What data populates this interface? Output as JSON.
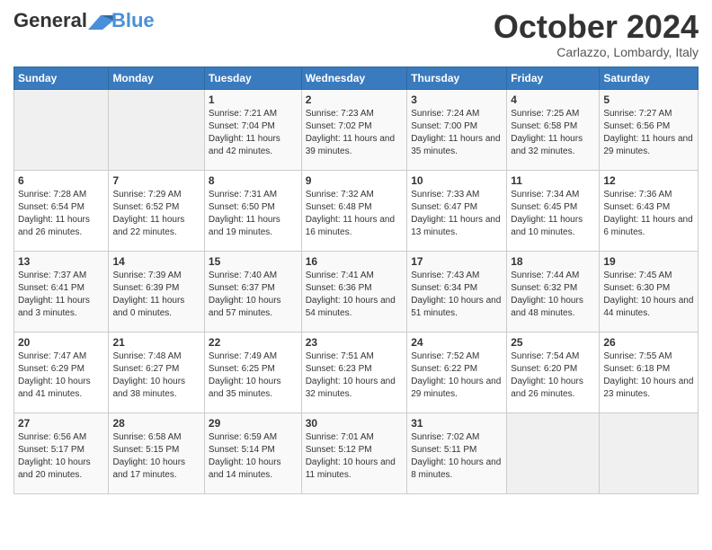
{
  "header": {
    "logo_line1": "General",
    "logo_line2": "Blue",
    "month": "October 2024",
    "location": "Carlazzo, Lombardy, Italy"
  },
  "days_of_week": [
    "Sunday",
    "Monday",
    "Tuesday",
    "Wednesday",
    "Thursday",
    "Friday",
    "Saturday"
  ],
  "weeks": [
    [
      {
        "day": "",
        "sunrise": "",
        "sunset": "",
        "daylight": ""
      },
      {
        "day": "",
        "sunrise": "",
        "sunset": "",
        "daylight": ""
      },
      {
        "day": "1",
        "sunrise": "Sunrise: 7:21 AM",
        "sunset": "Sunset: 7:04 PM",
        "daylight": "Daylight: 11 hours and 42 minutes."
      },
      {
        "day": "2",
        "sunrise": "Sunrise: 7:23 AM",
        "sunset": "Sunset: 7:02 PM",
        "daylight": "Daylight: 11 hours and 39 minutes."
      },
      {
        "day": "3",
        "sunrise": "Sunrise: 7:24 AM",
        "sunset": "Sunset: 7:00 PM",
        "daylight": "Daylight: 11 hours and 35 minutes."
      },
      {
        "day": "4",
        "sunrise": "Sunrise: 7:25 AM",
        "sunset": "Sunset: 6:58 PM",
        "daylight": "Daylight: 11 hours and 32 minutes."
      },
      {
        "day": "5",
        "sunrise": "Sunrise: 7:27 AM",
        "sunset": "Sunset: 6:56 PM",
        "daylight": "Daylight: 11 hours and 29 minutes."
      }
    ],
    [
      {
        "day": "6",
        "sunrise": "Sunrise: 7:28 AM",
        "sunset": "Sunset: 6:54 PM",
        "daylight": "Daylight: 11 hours and 26 minutes."
      },
      {
        "day": "7",
        "sunrise": "Sunrise: 7:29 AM",
        "sunset": "Sunset: 6:52 PM",
        "daylight": "Daylight: 11 hours and 22 minutes."
      },
      {
        "day": "8",
        "sunrise": "Sunrise: 7:31 AM",
        "sunset": "Sunset: 6:50 PM",
        "daylight": "Daylight: 11 hours and 19 minutes."
      },
      {
        "day": "9",
        "sunrise": "Sunrise: 7:32 AM",
        "sunset": "Sunset: 6:48 PM",
        "daylight": "Daylight: 11 hours and 16 minutes."
      },
      {
        "day": "10",
        "sunrise": "Sunrise: 7:33 AM",
        "sunset": "Sunset: 6:47 PM",
        "daylight": "Daylight: 11 hours and 13 minutes."
      },
      {
        "day": "11",
        "sunrise": "Sunrise: 7:34 AM",
        "sunset": "Sunset: 6:45 PM",
        "daylight": "Daylight: 11 hours and 10 minutes."
      },
      {
        "day": "12",
        "sunrise": "Sunrise: 7:36 AM",
        "sunset": "Sunset: 6:43 PM",
        "daylight": "Daylight: 11 hours and 6 minutes."
      }
    ],
    [
      {
        "day": "13",
        "sunrise": "Sunrise: 7:37 AM",
        "sunset": "Sunset: 6:41 PM",
        "daylight": "Daylight: 11 hours and 3 minutes."
      },
      {
        "day": "14",
        "sunrise": "Sunrise: 7:39 AM",
        "sunset": "Sunset: 6:39 PM",
        "daylight": "Daylight: 11 hours and 0 minutes."
      },
      {
        "day": "15",
        "sunrise": "Sunrise: 7:40 AM",
        "sunset": "Sunset: 6:37 PM",
        "daylight": "Daylight: 10 hours and 57 minutes."
      },
      {
        "day": "16",
        "sunrise": "Sunrise: 7:41 AM",
        "sunset": "Sunset: 6:36 PM",
        "daylight": "Daylight: 10 hours and 54 minutes."
      },
      {
        "day": "17",
        "sunrise": "Sunrise: 7:43 AM",
        "sunset": "Sunset: 6:34 PM",
        "daylight": "Daylight: 10 hours and 51 minutes."
      },
      {
        "day": "18",
        "sunrise": "Sunrise: 7:44 AM",
        "sunset": "Sunset: 6:32 PM",
        "daylight": "Daylight: 10 hours and 48 minutes."
      },
      {
        "day": "19",
        "sunrise": "Sunrise: 7:45 AM",
        "sunset": "Sunset: 6:30 PM",
        "daylight": "Daylight: 10 hours and 44 minutes."
      }
    ],
    [
      {
        "day": "20",
        "sunrise": "Sunrise: 7:47 AM",
        "sunset": "Sunset: 6:29 PM",
        "daylight": "Daylight: 10 hours and 41 minutes."
      },
      {
        "day": "21",
        "sunrise": "Sunrise: 7:48 AM",
        "sunset": "Sunset: 6:27 PM",
        "daylight": "Daylight: 10 hours and 38 minutes."
      },
      {
        "day": "22",
        "sunrise": "Sunrise: 7:49 AM",
        "sunset": "Sunset: 6:25 PM",
        "daylight": "Daylight: 10 hours and 35 minutes."
      },
      {
        "day": "23",
        "sunrise": "Sunrise: 7:51 AM",
        "sunset": "Sunset: 6:23 PM",
        "daylight": "Daylight: 10 hours and 32 minutes."
      },
      {
        "day": "24",
        "sunrise": "Sunrise: 7:52 AM",
        "sunset": "Sunset: 6:22 PM",
        "daylight": "Daylight: 10 hours and 29 minutes."
      },
      {
        "day": "25",
        "sunrise": "Sunrise: 7:54 AM",
        "sunset": "Sunset: 6:20 PM",
        "daylight": "Daylight: 10 hours and 26 minutes."
      },
      {
        "day": "26",
        "sunrise": "Sunrise: 7:55 AM",
        "sunset": "Sunset: 6:18 PM",
        "daylight": "Daylight: 10 hours and 23 minutes."
      }
    ],
    [
      {
        "day": "27",
        "sunrise": "Sunrise: 6:56 AM",
        "sunset": "Sunset: 5:17 PM",
        "daylight": "Daylight: 10 hours and 20 minutes."
      },
      {
        "day": "28",
        "sunrise": "Sunrise: 6:58 AM",
        "sunset": "Sunset: 5:15 PM",
        "daylight": "Daylight: 10 hours and 17 minutes."
      },
      {
        "day": "29",
        "sunrise": "Sunrise: 6:59 AM",
        "sunset": "Sunset: 5:14 PM",
        "daylight": "Daylight: 10 hours and 14 minutes."
      },
      {
        "day": "30",
        "sunrise": "Sunrise: 7:01 AM",
        "sunset": "Sunset: 5:12 PM",
        "daylight": "Daylight: 10 hours and 11 minutes."
      },
      {
        "day": "31",
        "sunrise": "Sunrise: 7:02 AM",
        "sunset": "Sunset: 5:11 PM",
        "daylight": "Daylight: 10 hours and 8 minutes."
      },
      {
        "day": "",
        "sunrise": "",
        "sunset": "",
        "daylight": ""
      },
      {
        "day": "",
        "sunrise": "",
        "sunset": "",
        "daylight": ""
      }
    ]
  ]
}
